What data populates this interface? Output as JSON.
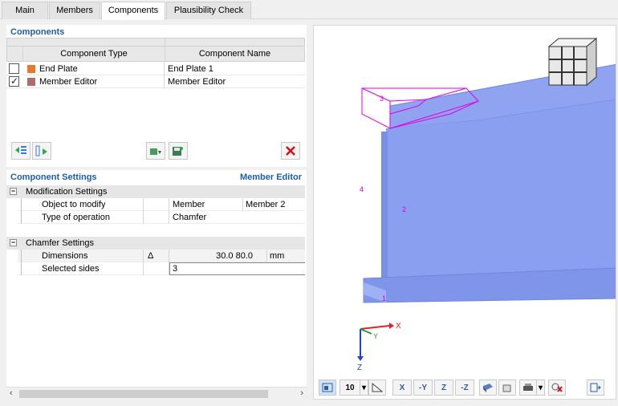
{
  "tabs": [
    {
      "label": "Main"
    },
    {
      "label": "Members"
    },
    {
      "label": "Components"
    },
    {
      "label": "Plausibility Check"
    }
  ],
  "components": {
    "title": "Components",
    "columns": {
      "type": "Component Type",
      "name": "Component Name"
    },
    "rows": [
      {
        "type": "End Plate",
        "name": "End Plate 1",
        "checked": false,
        "color": "#e8782c"
      },
      {
        "type": "Member Editor",
        "name": "Member Editor",
        "checked": true,
        "color": "#b06c6c"
      }
    ],
    "delete_icon": "red-x-icon"
  },
  "settings": {
    "title": "Component Settings",
    "context": "Member Editor",
    "groups": [
      {
        "label": "Modification Settings",
        "props": [
          {
            "name": "Object to modify",
            "symbol": "",
            "value": "Member",
            "extra": "Member 2"
          },
          {
            "name": "Type of operation",
            "symbol": "",
            "value": "Chamfer",
            "extra": ""
          }
        ]
      },
      {
        "label": "Chamfer Settings",
        "props": [
          {
            "name": "Dimensions",
            "symbol": "Δ",
            "value": "30.0 80.0",
            "extra": "mm"
          },
          {
            "name": "Selected sides",
            "symbol": "",
            "value": "3",
            "extra": ""
          }
        ]
      }
    ]
  },
  "viewport": {
    "labels": {
      "face1": "1",
      "face2": "2",
      "face3": "3",
      "face4": "4"
    },
    "axes": {
      "x": "X",
      "y": "Y",
      "z": "Z"
    },
    "toolbar": {
      "grid_value": "10",
      "x_label": "X",
      "y_label": "-Y",
      "z_label": "Z",
      "nz_label": "-Z"
    },
    "colors": {
      "beam": "#8fa3f0",
      "beam_dark": "#6f86e0",
      "selection": "#e000e0"
    }
  }
}
